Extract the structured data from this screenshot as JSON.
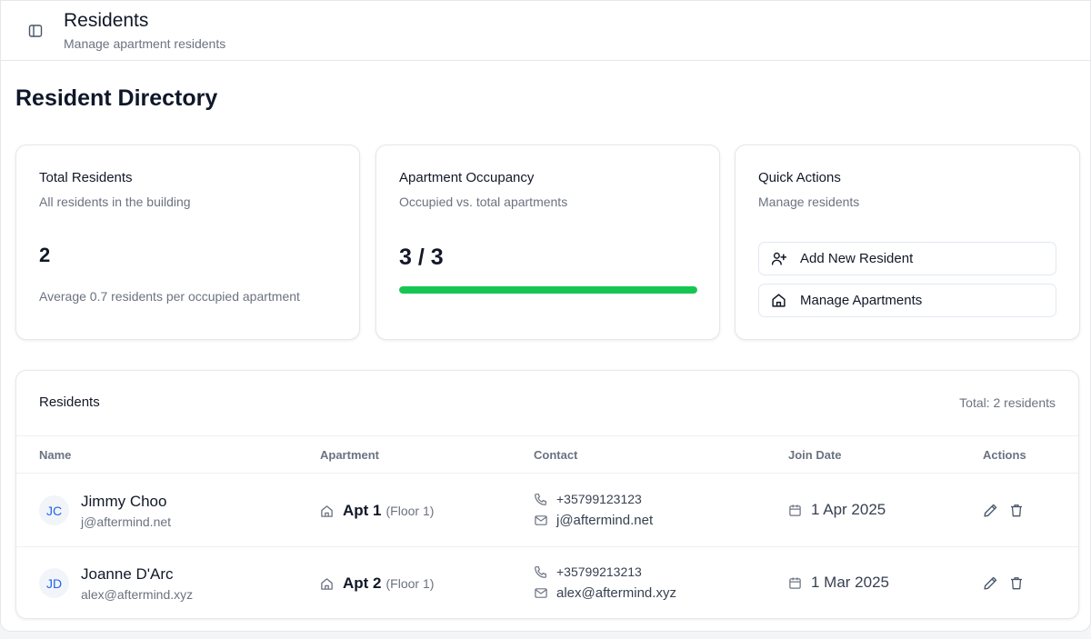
{
  "header": {
    "title": "Residents",
    "subtitle": "Manage apartment residents"
  },
  "page": {
    "heading": "Resident Directory"
  },
  "stats": {
    "total": {
      "title": "Total Residents",
      "description": "All residents in the building",
      "value": "2",
      "footnote": "Average 0.7 residents per occupied apartment"
    },
    "occupancy": {
      "title": "Apartment Occupancy",
      "description": "Occupied vs. total apartments",
      "value": "3 / 3",
      "progress_fraction": 1.0,
      "progress_color": "#16c653"
    },
    "quick_actions": {
      "title": "Quick Actions",
      "description": "Manage residents",
      "add_label": "Add New Resident",
      "add_icon": "user-plus-icon",
      "manage_label": "Manage Apartments",
      "manage_icon": "home-icon"
    }
  },
  "residents_table": {
    "title": "Residents",
    "total_label": "Total: 2 residents",
    "columns": [
      "Name",
      "Apartment",
      "Contact",
      "Join Date",
      "Actions"
    ],
    "rows": [
      {
        "initials": "JC",
        "name": "Jimmy Choo",
        "email": "j@aftermind.net",
        "apartment": "Apt 1",
        "floor": "(Floor 1)",
        "phone": "+35799123123",
        "contact_email": "j@aftermind.net",
        "join_date": "1 Apr 2025"
      },
      {
        "initials": "JD",
        "name": "Joanne D'Arc",
        "email": "alex@aftermind.xyz",
        "apartment": "Apt 2",
        "floor": "(Floor 1)",
        "phone": "+35799213213",
        "contact_email": "alex@aftermind.xyz",
        "join_date": "1 Mar 2025"
      }
    ]
  },
  "colors": {
    "accent": "#2563eb",
    "success": "#16c653"
  }
}
